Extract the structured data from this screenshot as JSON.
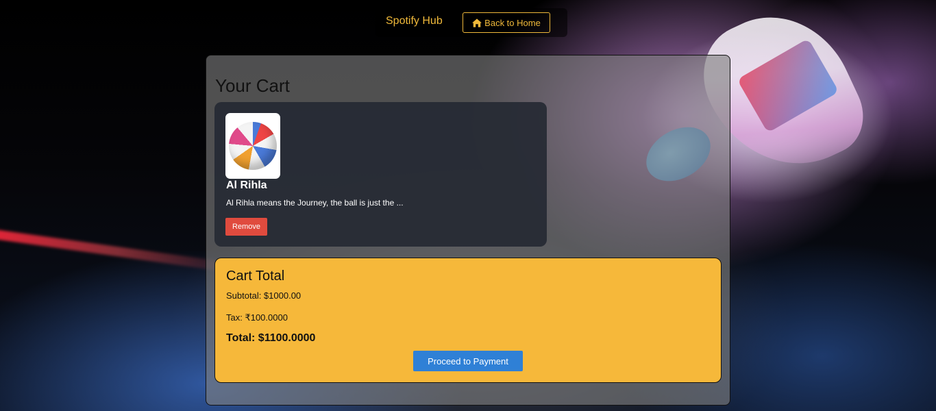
{
  "header": {
    "brand": "Spotify Hub",
    "home_button_label": "Back to Home",
    "home_icon": "home-icon"
  },
  "cart": {
    "title": "Your Cart",
    "items": [
      {
        "name": "Al Rihla",
        "description": "Al Rihla means the Journey, the ball is just the ...",
        "image_icon": "soccer-ball-image",
        "remove_label": "Remove"
      }
    ]
  },
  "totals": {
    "title": "Cart Total",
    "subtotal": "Subtotal: $1000.00",
    "tax": "Tax: ₹100.0000",
    "total": "Total: $1100.0000",
    "pay_label": "Proceed to Payment"
  },
  "colors": {
    "accent": "#f0b93a",
    "remove": "#e04b3e",
    "pay": "#2f80d6",
    "total_card": "#f6b83a"
  }
}
